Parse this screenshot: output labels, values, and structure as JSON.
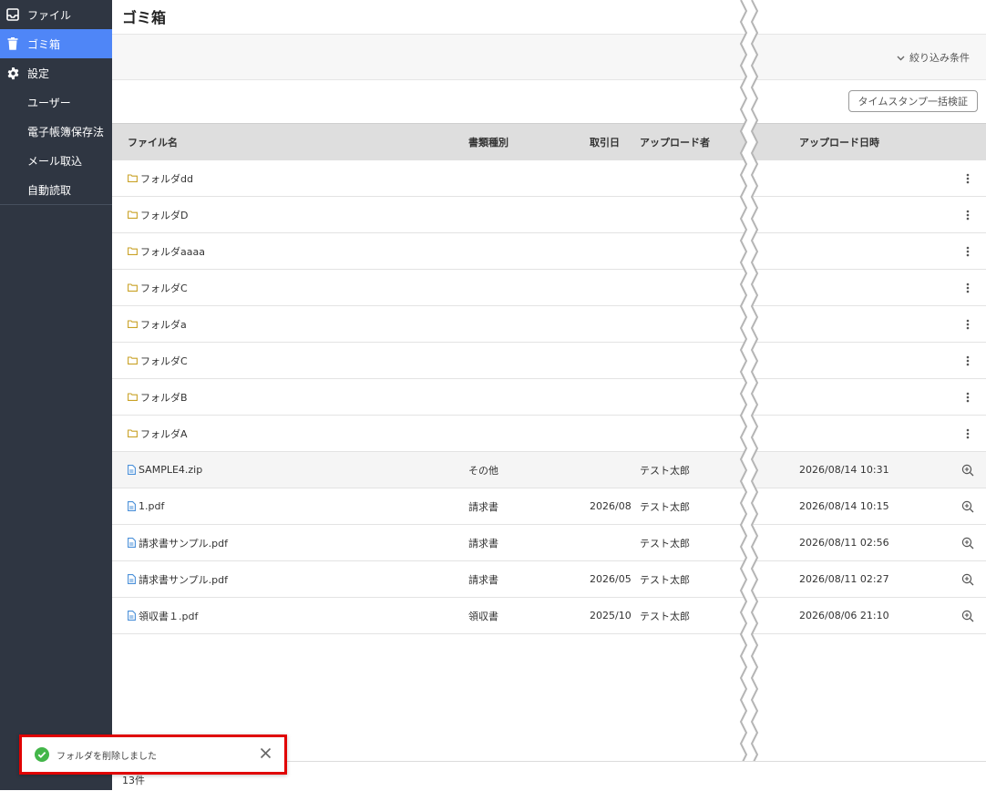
{
  "sidebar": {
    "items": [
      {
        "label": "ファイル",
        "icon": "inbox-icon"
      },
      {
        "label": "ゴミ箱",
        "icon": "trash-icon",
        "active": true
      },
      {
        "label": "設定",
        "icon": "gear-icon"
      },
      {
        "label": "ユーザー"
      },
      {
        "label": "電子帳簿保存法"
      },
      {
        "label": "メール取込"
      },
      {
        "label": "自動読取"
      }
    ]
  },
  "page": {
    "title": "ゴミ箱",
    "filter_label": "絞り込み条件",
    "timestamp_button": "タイムスタンプ一括検証"
  },
  "table": {
    "headers": [
      "ファイル名",
      "書類種別",
      "取引日",
      "アップロード者",
      "アップロード日時"
    ],
    "rows": [
      {
        "name": "フォルダdd",
        "kind": "folder"
      },
      {
        "name": "フォルダD",
        "kind": "folder"
      },
      {
        "name": "フォルダaaaa",
        "kind": "folder"
      },
      {
        "name": "フォルダC",
        "kind": "folder"
      },
      {
        "name": "フォルダa",
        "kind": "folder"
      },
      {
        "name": "フォルダC",
        "kind": "folder"
      },
      {
        "name": "フォルダB",
        "kind": "folder"
      },
      {
        "name": "フォルダA",
        "kind": "folder"
      },
      {
        "name": "SAMPLE4.zip",
        "kind": "file",
        "type": "その他",
        "date": "",
        "uploader": "テスト太郎",
        "uploaded_at": "2026/08/14 10:31"
      },
      {
        "name": "1.pdf",
        "kind": "file",
        "type": "請求書",
        "date": "2026/08",
        "uploader": "テスト太郎",
        "uploaded_at": "2026/08/14 10:15"
      },
      {
        "name": "請求書サンプル.pdf",
        "kind": "file",
        "type": "請求書",
        "date": "",
        "uploader": "テスト太郎",
        "uploaded_at": "2026/08/11 02:56"
      },
      {
        "name": "請求書サンプル.pdf",
        "kind": "file",
        "type": "請求書",
        "date": "2026/05",
        "uploader": "テスト太郎",
        "uploaded_at": "2026/08/11 02:27"
      },
      {
        "name": "領収書１.pdf",
        "kind": "file",
        "type": "領収書",
        "date": "2025/10",
        "uploader": "テスト太郎",
        "uploaded_at": "2026/08/06 21:10"
      }
    ]
  },
  "footer": {
    "count": "13件"
  },
  "toast": {
    "message": "フォルダを削除しました"
  },
  "colors": {
    "sidebar": "#2f3642",
    "active": "#4f86f7",
    "folder": "#c9a227",
    "file": "#4a90d9",
    "success": "#43b649",
    "toast_border": "#e00000"
  }
}
